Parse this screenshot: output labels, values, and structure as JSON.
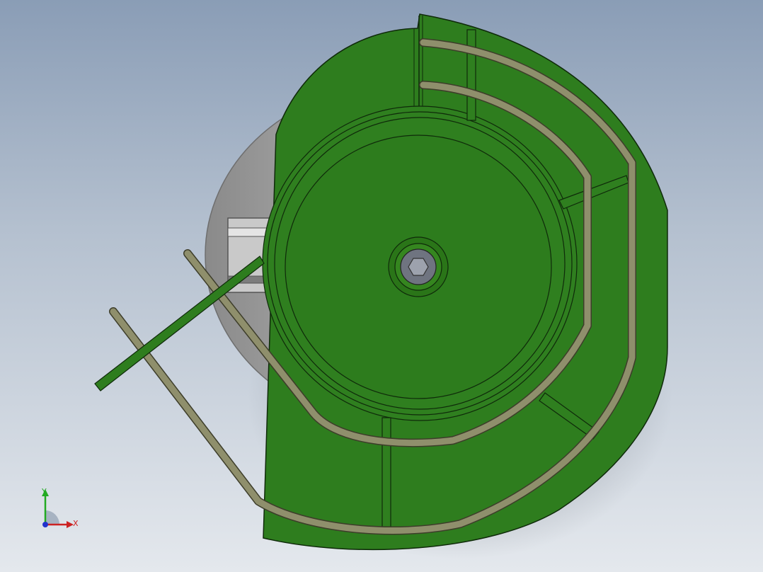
{
  "colors": {
    "background_top": "#8a9db6",
    "background_bottom": "#e4e8ed",
    "bowl_green": "#2e7d1e",
    "bowl_green_dark": "#24661a",
    "rail_tan": "#8f8f6c",
    "base_gray": "#9a9a9a",
    "axis_x": "#cc2222",
    "axis_y": "#22aa22",
    "axis_origin": "#2233cc"
  },
  "triad": {
    "x_label": "X",
    "y_label": "Y"
  }
}
